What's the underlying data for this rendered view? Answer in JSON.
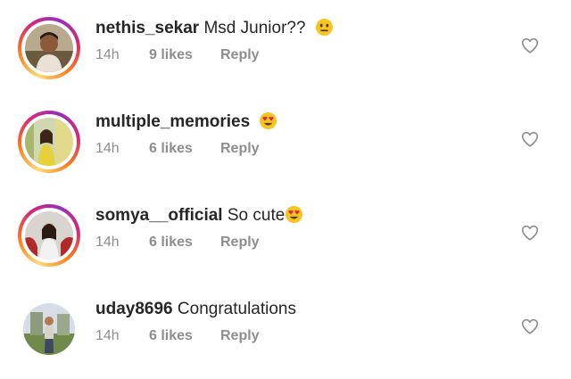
{
  "comments": [
    {
      "username": "nethis_sekar",
      "text": "Msd Junior??",
      "emoji": "neutral-face-emoji",
      "time": "14h",
      "likes": "9 likes",
      "reply": "Reply",
      "story_ring": true
    },
    {
      "username": "multiple_memories",
      "text": "",
      "emoji": "heart-eyes-emoji",
      "time": "14h",
      "likes": "6 likes",
      "reply": "Reply",
      "story_ring": true
    },
    {
      "username": "somya__official",
      "text": "So cute",
      "emoji": "heart-eyes-emoji",
      "time": "14h",
      "likes": "6 likes",
      "reply": "Reply",
      "story_ring": true
    },
    {
      "username": "uday8696",
      "text": "Congratulations",
      "emoji": "",
      "time": "14h",
      "likes": "6 likes",
      "reply": "Reply",
      "story_ring": false
    }
  ],
  "icons": {
    "like": "heart-outline-icon"
  },
  "colors": {
    "meta_text": "#8e8e8e",
    "primary_text": "#262626",
    "heart_stroke": "#8e8e8e"
  }
}
